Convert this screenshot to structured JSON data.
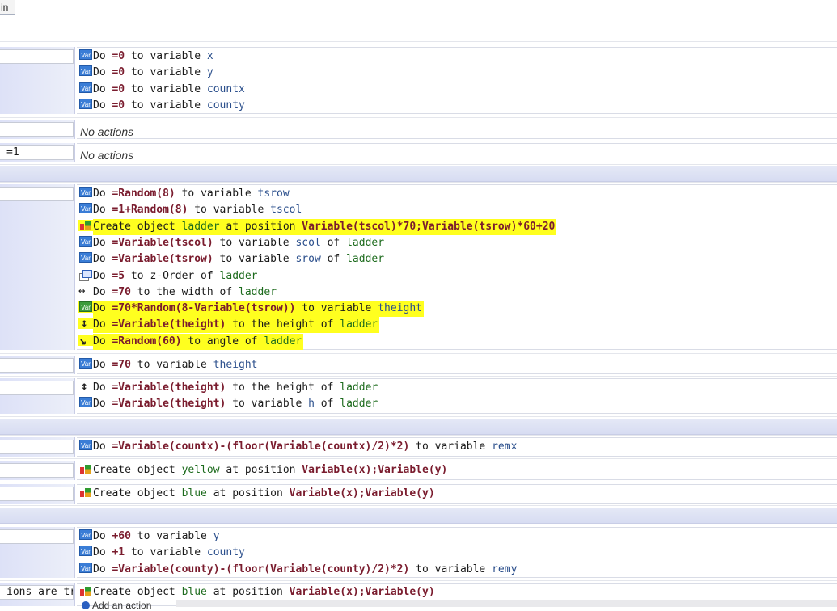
{
  "tab": {
    "label": "in"
  },
  "events": [
    {
      "id": "e1",
      "condition": "",
      "actions": [
        {
          "icon": "var-icon",
          "parts": [
            [
              "k",
              "Do "
            ],
            [
              "n",
              "=0"
            ],
            [
              "k",
              " to variable "
            ],
            [
              "v",
              "x"
            ]
          ]
        },
        {
          "icon": "var-icon",
          "parts": [
            [
              "k",
              "Do "
            ],
            [
              "n",
              "=0"
            ],
            [
              "k",
              " to variable "
            ],
            [
              "v",
              "y"
            ]
          ]
        },
        {
          "icon": "var-icon",
          "parts": [
            [
              "k",
              "Do "
            ],
            [
              "n",
              "=0"
            ],
            [
              "k",
              " to variable "
            ],
            [
              "v",
              "countx"
            ]
          ]
        },
        {
          "icon": "var-icon",
          "parts": [
            [
              "k",
              "Do "
            ],
            [
              "n",
              "=0"
            ],
            [
              "k",
              " to variable "
            ],
            [
              "v",
              "county"
            ]
          ]
        }
      ]
    },
    {
      "id": "e2",
      "condition": "",
      "no_actions": "No actions"
    },
    {
      "id": "e3",
      "condition": "=1",
      "no_actions": "No actions"
    },
    {
      "id": "e4",
      "condition": "",
      "actions": [
        {
          "icon": "var-icon",
          "parts": [
            [
              "k",
              "Do "
            ],
            [
              "n",
              "=Random(8)"
            ],
            [
              "k",
              " to variable "
            ],
            [
              "v",
              "tsrow"
            ]
          ]
        },
        {
          "icon": "var-icon",
          "parts": [
            [
              "k",
              "Do "
            ],
            [
              "n",
              "=1+Random(8)"
            ],
            [
              "k",
              " to variable "
            ],
            [
              "v",
              "tscol"
            ]
          ]
        },
        {
          "icon": "create-icon",
          "highlight": true,
          "parts": [
            [
              "k",
              "Create object "
            ],
            [
              "o",
              "ladder"
            ],
            [
              "k",
              " at position "
            ],
            [
              "n",
              "Variable(tscol)*70;Variable(tsrow)*60+20"
            ]
          ]
        },
        {
          "icon": "var-icon",
          "parts": [
            [
              "k",
              "Do "
            ],
            [
              "n",
              "=Variable(tscol)"
            ],
            [
              "k",
              " to variable "
            ],
            [
              "v",
              "scol"
            ],
            [
              "k",
              " of "
            ],
            [
              "o",
              "ladder"
            ]
          ]
        },
        {
          "icon": "var-icon",
          "parts": [
            [
              "k",
              "Do "
            ],
            [
              "n",
              "=Variable(tsrow)"
            ],
            [
              "k",
              " to variable "
            ],
            [
              "v",
              "srow"
            ],
            [
              "k",
              " of "
            ],
            [
              "o",
              "ladder"
            ]
          ]
        },
        {
          "icon": "zorder-icon",
          "parts": [
            [
              "k",
              "Do "
            ],
            [
              "n",
              "=5"
            ],
            [
              "k",
              " to z-Order of "
            ],
            [
              "o",
              "ladder"
            ]
          ]
        },
        {
          "icon": "width-icon",
          "parts": [
            [
              "k",
              "Do "
            ],
            [
              "n",
              "=70"
            ],
            [
              "k",
              " to the width of "
            ],
            [
              "o",
              "ladder"
            ]
          ]
        },
        {
          "icon": "var-icon-green",
          "highlight": true,
          "parts": [
            [
              "k",
              "Do "
            ],
            [
              "n",
              "=70*Random(8-Variable(tsrow))"
            ],
            [
              "k",
              " to variable "
            ],
            [
              "v",
              "theight"
            ]
          ]
        },
        {
          "icon": "height-icon",
          "highlight": true,
          "parts": [
            [
              "k",
              "Do "
            ],
            [
              "n",
              "=Variable(theight)"
            ],
            [
              "k",
              " to the height of "
            ],
            [
              "o",
              "ladder"
            ]
          ]
        },
        {
          "icon": "angle-icon",
          "highlight": true,
          "parts": [
            [
              "k",
              "Do "
            ],
            [
              "n",
              "=Random(60)"
            ],
            [
              "k",
              " to angle of "
            ],
            [
              "o",
              "ladder"
            ]
          ]
        }
      ]
    },
    {
      "id": "e5",
      "condition": "",
      "actions": [
        {
          "icon": "var-icon",
          "parts": [
            [
              "k",
              "Do "
            ],
            [
              "n",
              "=70"
            ],
            [
              "k",
              " to variable "
            ],
            [
              "v",
              "theight"
            ]
          ]
        }
      ]
    },
    {
      "id": "e6",
      "condition": "",
      "actions": [
        {
          "icon": "height-icon",
          "parts": [
            [
              "k",
              "Do "
            ],
            [
              "n",
              "=Variable(theight)"
            ],
            [
              "k",
              " to the height of "
            ],
            [
              "o",
              "ladder"
            ]
          ]
        },
        {
          "icon": "var-icon",
          "parts": [
            [
              "k",
              "Do "
            ],
            [
              "n",
              "=Variable(theight)"
            ],
            [
              "k",
              " to variable "
            ],
            [
              "v",
              "h"
            ],
            [
              "k",
              " of "
            ],
            [
              "o",
              "ladder"
            ]
          ]
        }
      ]
    },
    {
      "id": "e7",
      "condition": "",
      "actions": [
        {
          "icon": "var-icon",
          "parts": [
            [
              "k",
              "Do "
            ],
            [
              "n",
              "=Variable(countx)-(floor(Variable(countx)/2)*2)"
            ],
            [
              "k",
              " to variable "
            ],
            [
              "v",
              "remx"
            ]
          ]
        }
      ]
    },
    {
      "id": "e8",
      "condition": "",
      "actions": [
        {
          "icon": "create-icon",
          "parts": [
            [
              "k",
              "Create object "
            ],
            [
              "o",
              "yellow"
            ],
            [
              "k",
              " at position "
            ],
            [
              "n",
              "Variable(x);Variable(y)"
            ]
          ]
        }
      ]
    },
    {
      "id": "e9",
      "condition": "",
      "actions": [
        {
          "icon": "create-icon",
          "parts": [
            [
              "k",
              "Create object "
            ],
            [
              "o",
              "blue"
            ],
            [
              "k",
              " at position "
            ],
            [
              "n",
              "Variable(x);Variable(y)"
            ]
          ]
        }
      ]
    },
    {
      "id": "e10",
      "condition": "",
      "actions": [
        {
          "icon": "var-icon",
          "parts": [
            [
              "k",
              "Do "
            ],
            [
              "n",
              "+60"
            ],
            [
              "k",
              " to variable "
            ],
            [
              "v",
              "y"
            ]
          ]
        },
        {
          "icon": "var-icon",
          "parts": [
            [
              "k",
              "Do "
            ],
            [
              "n",
              "+1"
            ],
            [
              "k",
              " to variable "
            ],
            [
              "v",
              "county"
            ]
          ]
        },
        {
          "icon": "var-icon",
          "parts": [
            [
              "k",
              "Do "
            ],
            [
              "n",
              "=Variable(county)-(floor(Variable(county)/2)*2)"
            ],
            [
              "k",
              " to variable "
            ],
            [
              "v",
              "remy"
            ]
          ]
        }
      ]
    },
    {
      "id": "e11",
      "condition": "ions are tr",
      "actions": [
        {
          "icon": "create-icon",
          "parts": [
            [
              "k",
              "Create object "
            ],
            [
              "o",
              "blue"
            ],
            [
              "k",
              " at position "
            ],
            [
              "n",
              "Variable(x);Variable(y)"
            ]
          ]
        }
      ]
    }
  ],
  "add_action": "Add an action"
}
